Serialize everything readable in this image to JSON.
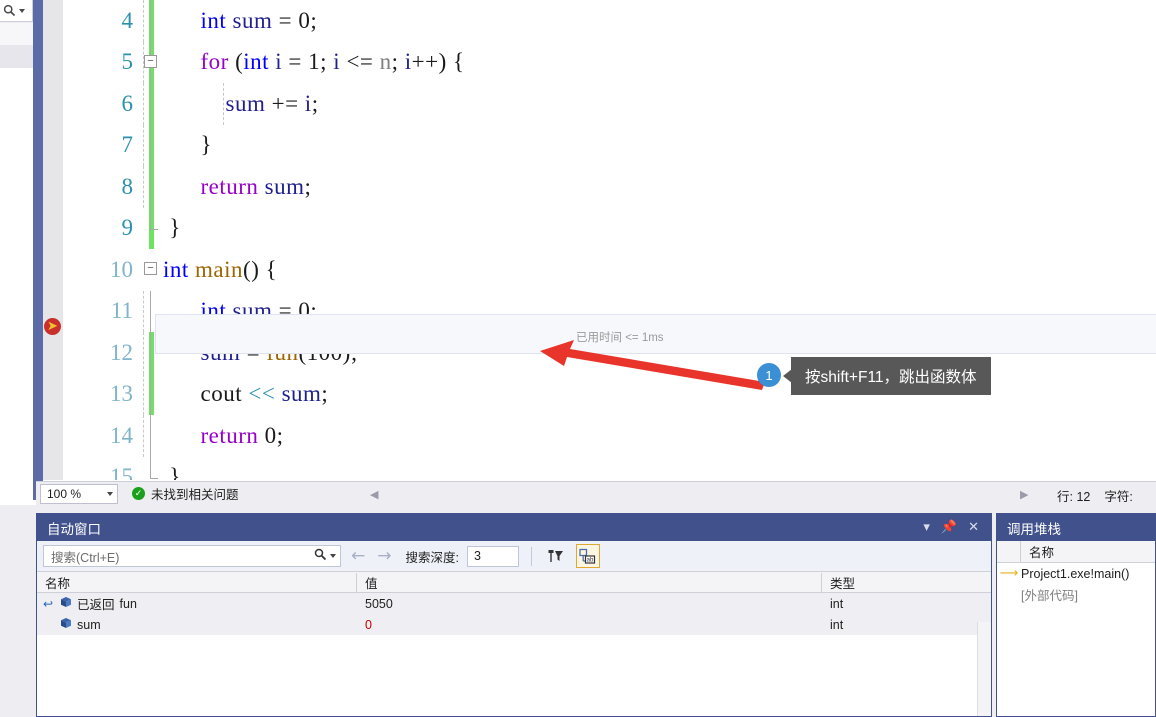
{
  "editor": {
    "gutter_icon": "breakpoint-current-statement-icon",
    "current_line": 12,
    "lines": [
      {
        "num": "4",
        "text": "int sum = 0;"
      },
      {
        "num": "5",
        "text": "for (int i = 1; i <= n; i++) {"
      },
      {
        "num": "6",
        "text": "sum += i;"
      },
      {
        "num": "7",
        "text": "}"
      },
      {
        "num": "8",
        "text": "return sum;"
      },
      {
        "num": "9",
        "text": "}"
      },
      {
        "num": "10",
        "text": "int main() {"
      },
      {
        "num": "11",
        "text": "int sum = 0;"
      },
      {
        "num": "12",
        "text": "sum = fun(100);"
      },
      {
        "num": "13",
        "text": "cout << sum;"
      },
      {
        "num": "14",
        "text": "return 0;"
      },
      {
        "num": "15",
        "text": "}"
      }
    ],
    "inline_time_hint": "已用时间 <= 1ms"
  },
  "annotation": {
    "badge_number": "1",
    "callout_text": "按shift+F11，跳出函数体",
    "arrow_color": "#e8342a",
    "badge_color": "#3b8fd4",
    "bubble_color": "#585858"
  },
  "status_bar": {
    "zoom_value": "100 %",
    "issue_status": "未找到相关问题",
    "line_label": "行: 12",
    "char_label": "字符:"
  },
  "autos_panel": {
    "title": "自动窗口",
    "window_buttons": [
      "chevron-down-icon",
      "pin-icon",
      "close-icon"
    ],
    "search_placeholder": "搜索(Ctrl+E)",
    "depth_label": "搜索深度:",
    "depth_value": "3",
    "toolbar_icons": [
      "pin-filter-icon",
      "show-raw-structure-icon"
    ],
    "columns": [
      "名称",
      "值",
      "类型"
    ],
    "rows": [
      {
        "name_prefix": "已返回",
        "name": "fun",
        "value": "5050",
        "type": "int",
        "value_modified": false
      },
      {
        "name_prefix": "",
        "name": "sum",
        "value": "0",
        "type": "int",
        "value_modified": true
      }
    ]
  },
  "callstack_panel": {
    "title": "调用堆栈",
    "column": "名称",
    "rows": [
      {
        "label": "Project1.exe!main()",
        "current": true
      },
      {
        "label": "[外部代码]",
        "current": false
      }
    ]
  },
  "left_rail": {
    "search_icon": "search-icon",
    "dropdown_icon": "chevron-down-icon"
  },
  "colors": {
    "accent_blue": "#41518b",
    "rail_accent": "#5a6ba8",
    "change_bar_green": "#6ee362",
    "linenum_blue": "#2b91af",
    "modified_value_red": "#c80000"
  }
}
